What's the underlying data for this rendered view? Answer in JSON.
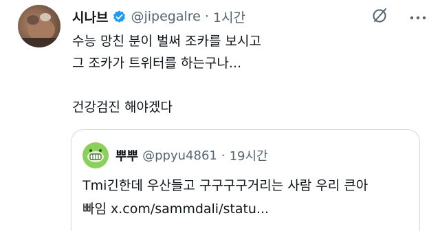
{
  "tweet": {
    "author_name": "시나브",
    "handle": "@jipegalre",
    "separator": "·",
    "time": "1시간",
    "lines": [
      "수능 망친 분이 벌써 조카를 보시고",
      "그 조카가 트위터를 하는구나...",
      "",
      "건강검진 해야겠다"
    ]
  },
  "quote": {
    "author_name": "뿌뿌",
    "handle": "@ppyu4861",
    "separator": "·",
    "time": "19시간",
    "lines": [
      "Tmi긴한데 우산들고 구구구구거리는 사람 우리 큰아",
      "빠임 x.com/sammdali/statu..."
    ]
  },
  "icons": {
    "verified": "verified-badge-icon",
    "grok": "grok-icon",
    "more": "more-options-icon"
  },
  "colors": {
    "verified": "#1d9bf0",
    "secondary_text": "#536471",
    "border": "#cfd9de",
    "quote_avatar": "#8ccf5a"
  }
}
